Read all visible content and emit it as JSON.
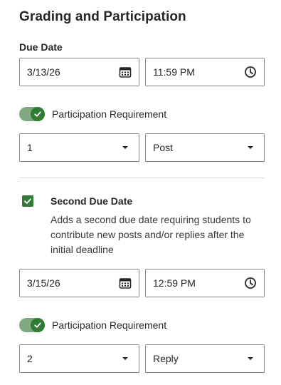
{
  "header": {
    "title": "Grading and Participation"
  },
  "due": {
    "label": "Due Date",
    "date": "3/13/26",
    "time": "11:59 PM"
  },
  "participation1": {
    "label": "Participation Requirement",
    "count": "1",
    "type": "Post"
  },
  "second": {
    "checkbox_label": "Second Due Date",
    "description": "Adds a second due date requiring students to contribute new posts and/or replies after the initial deadline",
    "date": "3/15/26",
    "time": "12:59 PM"
  },
  "participation2": {
    "label": "Participation Requirement",
    "count": "2",
    "type": "Reply"
  },
  "colors": {
    "accent": "#2e7d32",
    "toggle_track": "#7faa80",
    "border": "#8a8a8a"
  }
}
